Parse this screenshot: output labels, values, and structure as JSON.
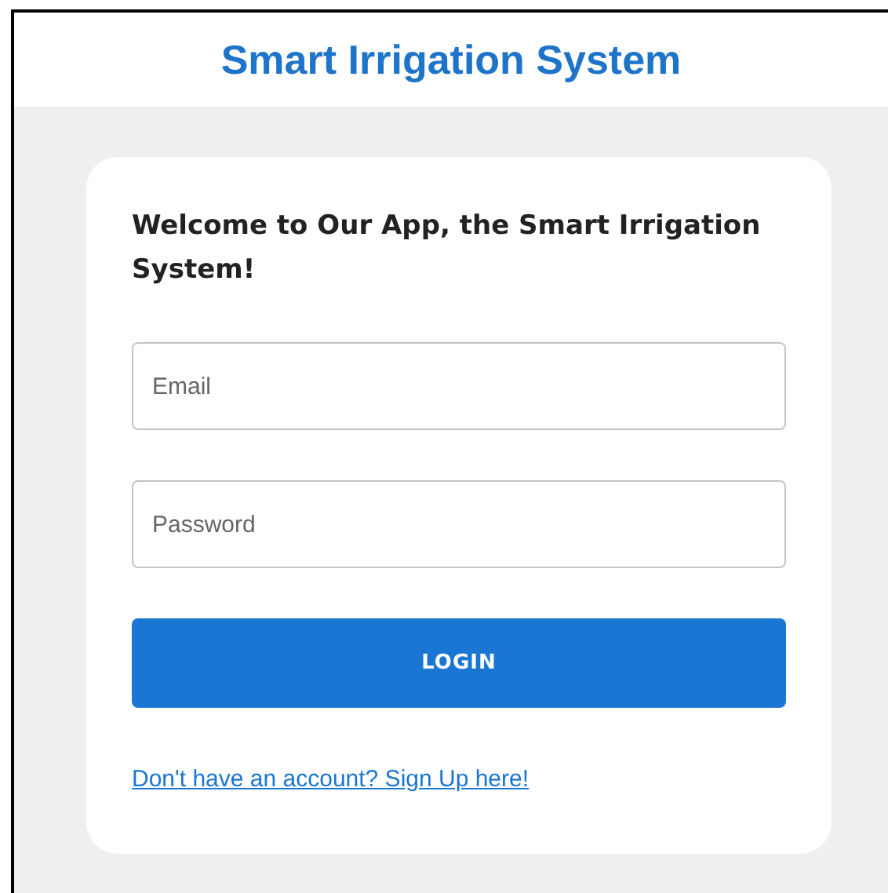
{
  "header": {
    "title": "Smart Irrigation System"
  },
  "login_card": {
    "heading": "Welcome to Our App, the Smart Irrigation System!",
    "fields": [
      {
        "placeholder": "Email"
      },
      {
        "placeholder": "Password"
      }
    ],
    "button": "LOGIN",
    "signup_link": "Don't have an account? Sign Up here!"
  }
}
